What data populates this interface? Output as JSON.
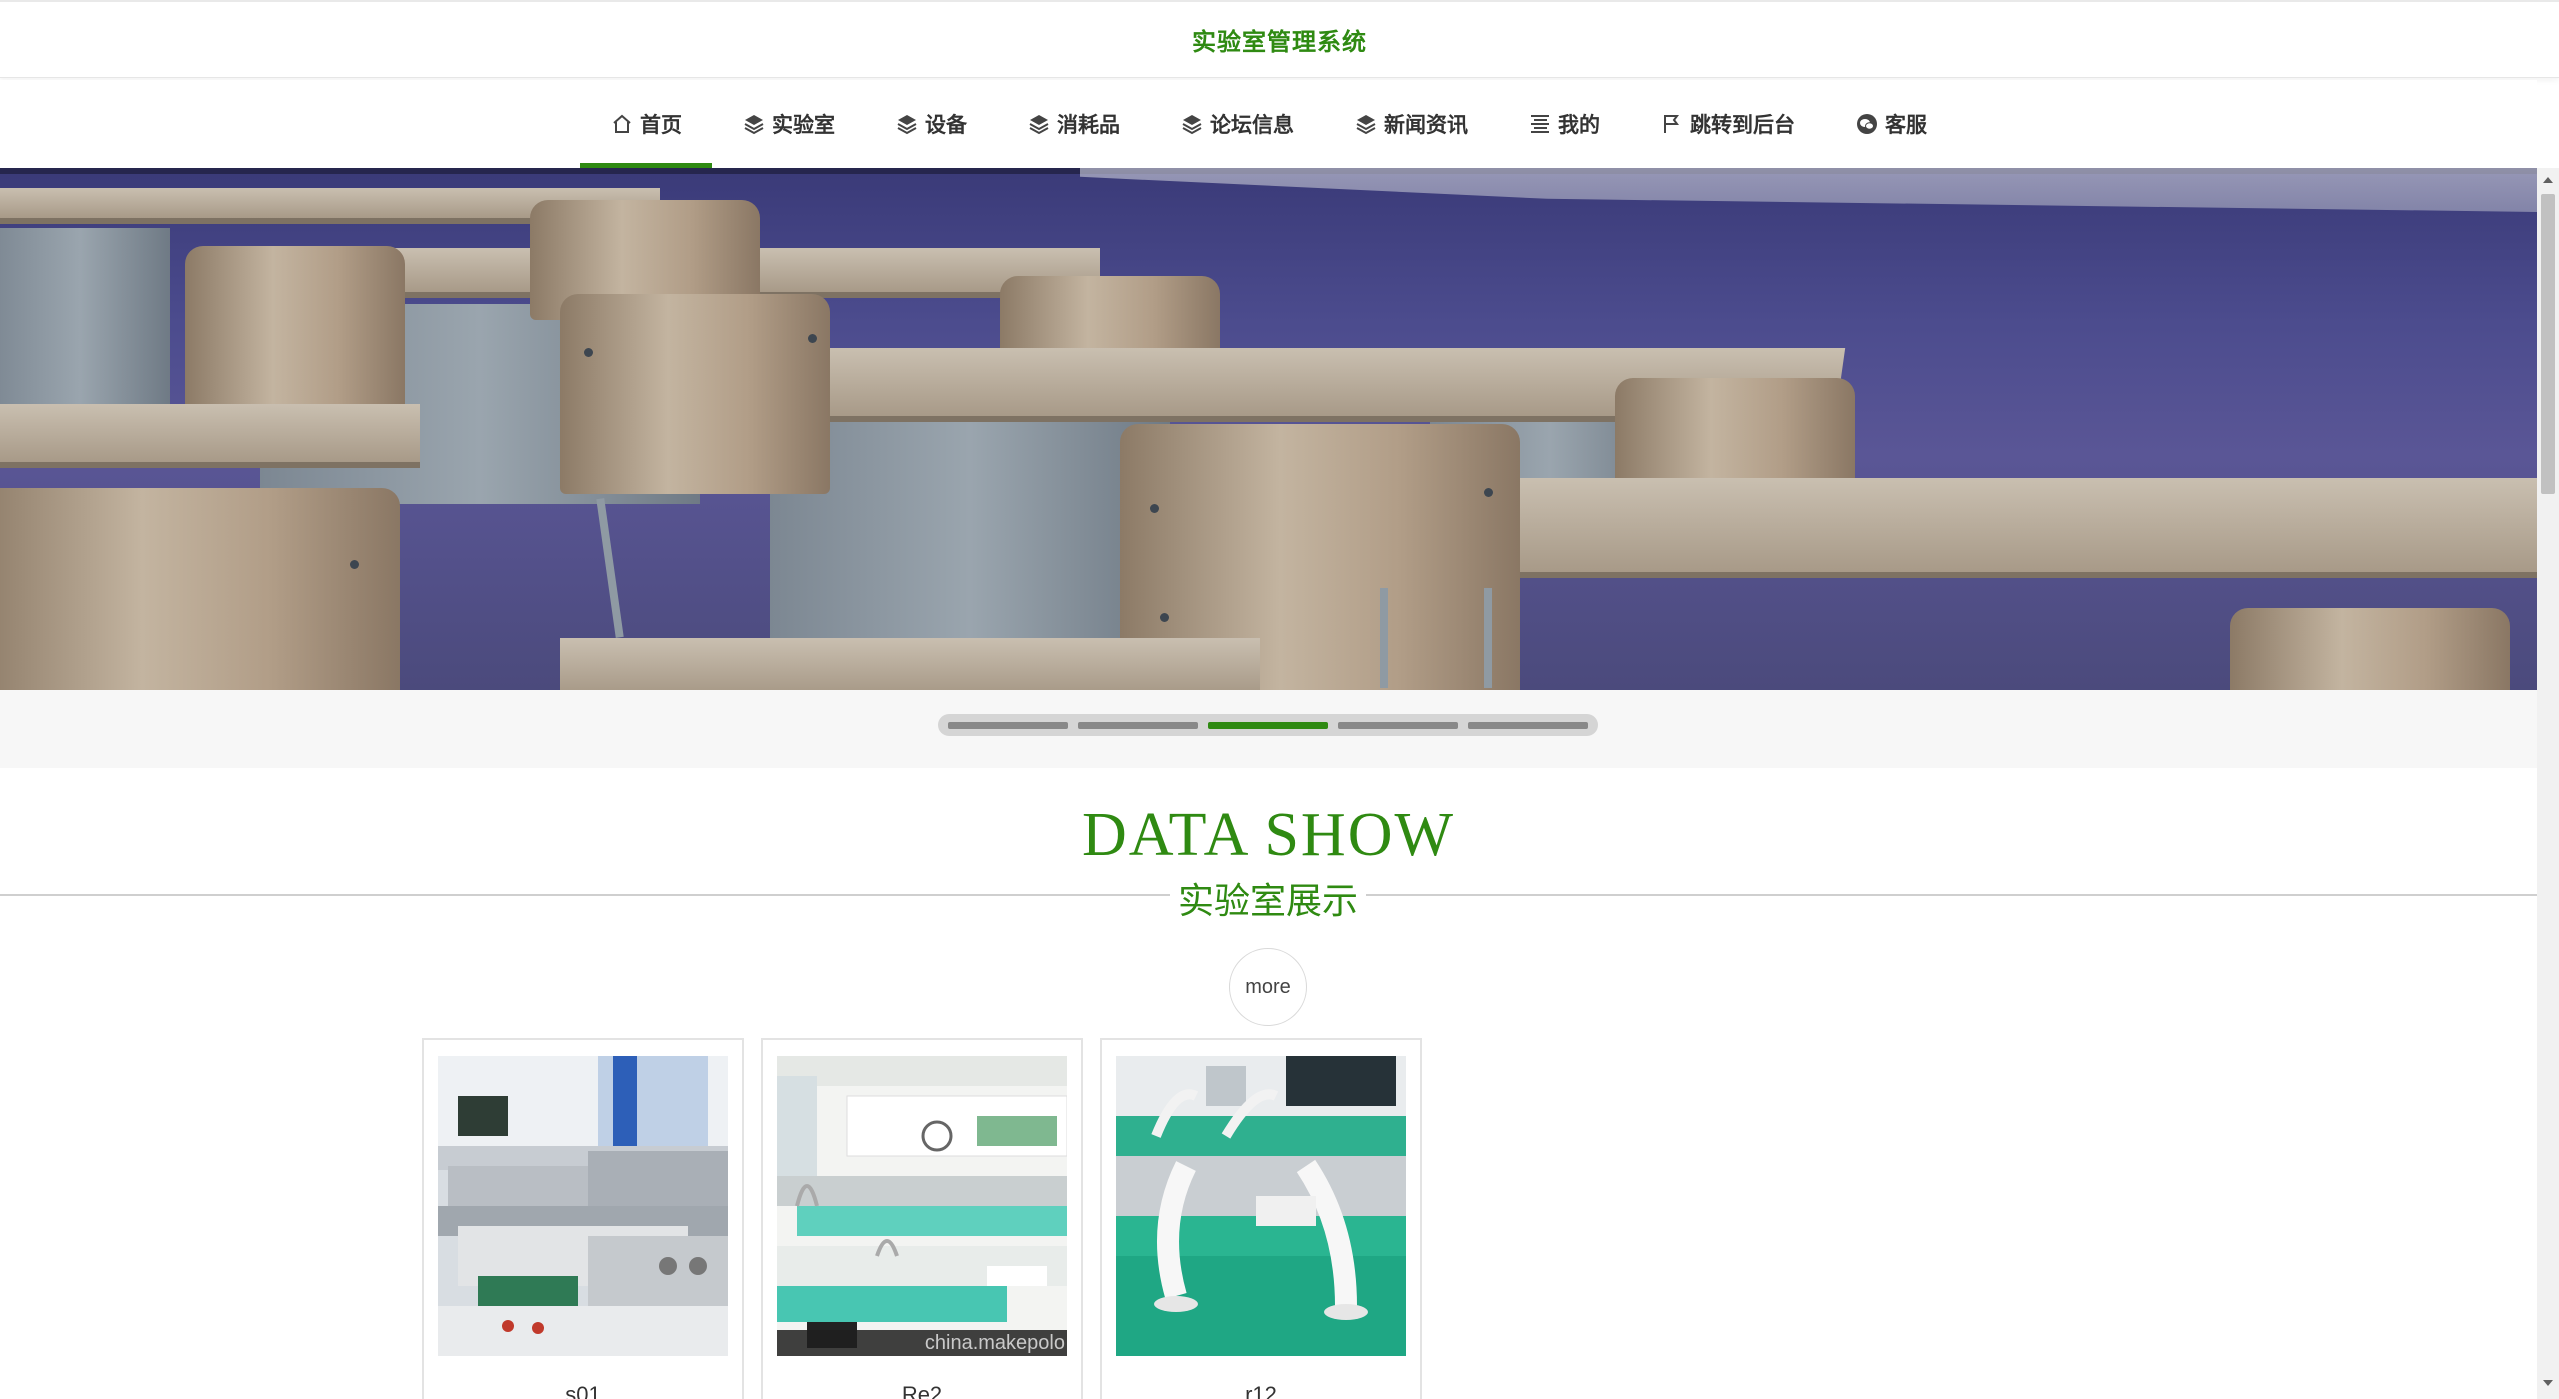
{
  "header": {
    "title": "实验室管理系统"
  },
  "nav": {
    "items": [
      {
        "label": "首页",
        "icon": "home-icon",
        "active": true
      },
      {
        "label": "实验室",
        "icon": "layers-icon"
      },
      {
        "label": "设备",
        "icon": "layers-icon"
      },
      {
        "label": "消耗品",
        "icon": "layers-icon"
      },
      {
        "label": "论坛信息",
        "icon": "layers-icon"
      },
      {
        "label": "新闻资讯",
        "icon": "layers-icon"
      },
      {
        "label": "我的",
        "icon": "list-icon"
      },
      {
        "label": "跳转到后台",
        "icon": "flag-icon"
      },
      {
        "label": "客服",
        "icon": "wechat-icon"
      }
    ]
  },
  "banner": {
    "slide_count": 5,
    "active_slide": 3
  },
  "section": {
    "title_en": "DATA SHOW",
    "title_zh": "实验室展示",
    "more_label": "more"
  },
  "cards": [
    {
      "name": "s01"
    },
    {
      "name": "Re2"
    },
    {
      "name": "r12",
      "watermark": ""
    }
  ],
  "card_watermark": "china.makepolo",
  "colors": {
    "accent": "#2f8a12",
    "banner_wall": "#4c4c8e"
  }
}
